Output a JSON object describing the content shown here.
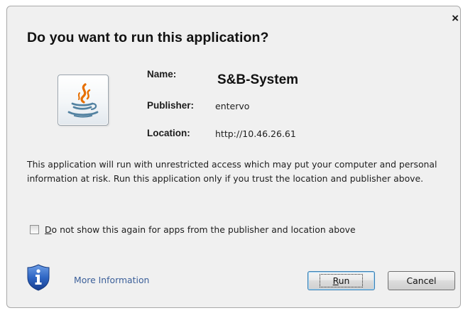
{
  "dialog": {
    "title": "Do you want to run this application?",
    "close_glyph": "×"
  },
  "app": {
    "icon": "java-coffee-cup-icon",
    "name_label": "Name:",
    "name_value": "S&B-System",
    "publisher_label": "Publisher:",
    "publisher_value": "entervo",
    "location_label": "Location:",
    "location_value": "http://10.46.26.61"
  },
  "warning_text": "This application will run with unrestricted access which may put your computer and personal information at risk. Run this application only if you trust the location and publisher above.",
  "checkbox": {
    "checked": false,
    "label_mnemonic": "D",
    "label_rest": "o not show this again for apps from the publisher and location above"
  },
  "footer": {
    "info_icon": "shield-info-icon",
    "more_info_label": "More Information",
    "run_mnemonic": "R",
    "run_rest": "un",
    "cancel_label": "Cancel"
  },
  "colors": {
    "dialog_bg": "#f0f0f0",
    "link": "#3b5f99",
    "shield_blue": "#2a5db0",
    "java_orange": "#e76f00",
    "java_blue": "#5382a1"
  }
}
